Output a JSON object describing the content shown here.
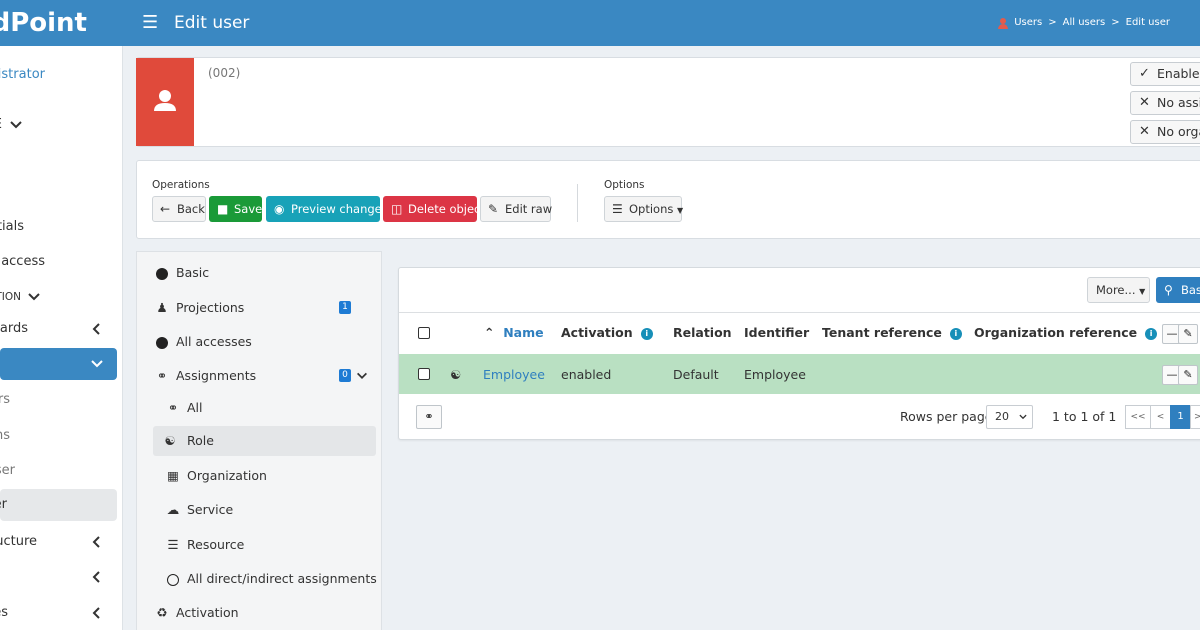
{
  "app": {
    "logo_text": "dPoint",
    "page_title": "Edit user"
  },
  "breadcrumb": [
    "Users",
    ">",
    "All users",
    ">",
    "Edit user"
  ],
  "sidebar": {
    "items": [
      {
        "label": "nistrator"
      },
      {
        "label": "E"
      },
      {
        "label": "tials"
      },
      {
        "label": "st access"
      },
      {
        "label": "TION"
      },
      {
        "label": "oards"
      },
      {
        "label": ""
      },
      {
        "label": "rs"
      },
      {
        "label": "ns"
      },
      {
        "label": "ser"
      },
      {
        "label": "ser"
      },
      {
        "label": "ructure"
      },
      {
        "label": ""
      },
      {
        "label": "es"
      }
    ]
  },
  "object": {
    "oid": "(002)",
    "tags": [
      "Enabled",
      "No assignments",
      "No organizations"
    ]
  },
  "operations": {
    "label": "Operations",
    "back": "Back",
    "save": "Save",
    "preview": "Preview changes",
    "delete": "Delete object",
    "edit_raw": "Edit raw"
  },
  "options": {
    "label": "Options",
    "button": "Options"
  },
  "menu": {
    "items": [
      {
        "label": "Basic"
      },
      {
        "label": "Projections",
        "badge": "1"
      },
      {
        "label": "All accesses"
      },
      {
        "label": "Assignments",
        "badge": "0"
      },
      {
        "label": "All"
      },
      {
        "label": "Role"
      },
      {
        "label": "Organization"
      },
      {
        "label": "Service"
      },
      {
        "label": "Resource"
      },
      {
        "label": "All direct/indirect assignments"
      },
      {
        "label": "Activation"
      }
    ]
  },
  "table": {
    "more_button": "More...",
    "search_button": "Basic",
    "columns": [
      "Name",
      "Activation",
      "Relation",
      "Identifier",
      "Tenant reference",
      "Organization reference"
    ],
    "rows": [
      {
        "name": "Employee",
        "activation": "enabled",
        "relation": "Default",
        "identifier": "Employee"
      }
    ],
    "footer": {
      "rows_per_page_label": "Rows per page",
      "rows_per_page_value": "20",
      "range_text": "1 to 1 of 1",
      "pager": [
        "<<",
        "<",
        "1",
        ">"
      ]
    }
  },
  "colors": {
    "topbar": "#3a88c2",
    "avatar": "#e04a3b",
    "save": "#1a9a38",
    "preview": "#18a2b8",
    "delete": "#dc3545",
    "row_highlight": "#b9e0c2",
    "badge": "#1e7bd4"
  }
}
